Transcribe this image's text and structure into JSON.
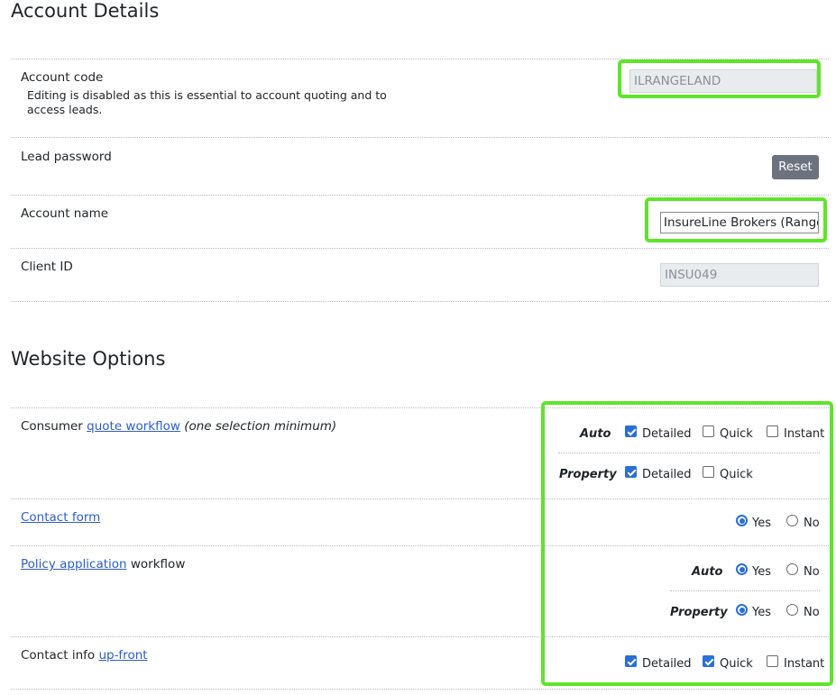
{
  "account_details": {
    "heading": "Account Details",
    "account_code": {
      "label": "Account code",
      "help": "Editing is disabled as this is essential to account quoting and to access leads.",
      "value": "ILRANGELAND"
    },
    "lead_password": {
      "label": "Lead password",
      "reset_label": "Reset"
    },
    "account_name": {
      "label": "Account name",
      "value": "InsureLine Brokers (Rangel"
    },
    "client_id": {
      "label": "Client ID",
      "value": "INSU049"
    }
  },
  "website_options": {
    "heading": "Website Options",
    "consumer_quote": {
      "prefix": "Consumer ",
      "link": "quote workflow",
      "suffix": "(one selection minimum)",
      "auto_label": "Auto",
      "property_label": "Property",
      "auto_options": [
        {
          "label": "Detailed",
          "checked": true
        },
        {
          "label": "Quick",
          "checked": false
        },
        {
          "label": "Instant",
          "checked": false
        }
      ],
      "property_options": [
        {
          "label": "Detailed",
          "checked": true
        },
        {
          "label": "Quick",
          "checked": false
        }
      ]
    },
    "contact_form": {
      "link": "Contact form",
      "yes": "Yes",
      "no": "No",
      "selected": "Yes"
    },
    "policy_application": {
      "link": "Policy application",
      "suffix": " workflow",
      "auto_label": "Auto",
      "property_label": "Property",
      "yes": "Yes",
      "no": "No",
      "auto_selected": "Yes",
      "property_selected": "Yes"
    },
    "contact_info": {
      "prefix": "Contact info ",
      "link": "up-front",
      "options": [
        {
          "label": "Detailed",
          "checked": true
        },
        {
          "label": "Quick",
          "checked": true
        },
        {
          "label": "Instant",
          "checked": false
        }
      ]
    }
  },
  "colors": {
    "highlight": "#5ee52a",
    "link": "#2d5ec7",
    "check": "#2b6fd6",
    "button": "#6c737f"
  }
}
